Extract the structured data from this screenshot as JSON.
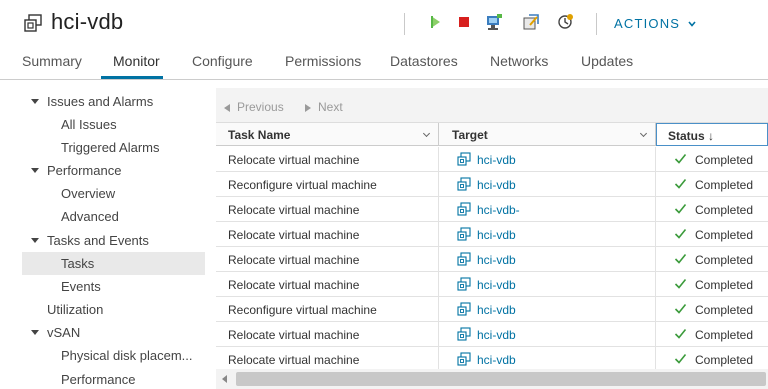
{
  "header": {
    "title": "hci-vdb",
    "actions_label": "ACTIONS",
    "colors": {
      "accent": "#0072a3",
      "power_on": "#57b846",
      "power_off": "#d7201e"
    }
  },
  "tabs": [
    {
      "label": "Summary"
    },
    {
      "label": "Monitor",
      "active": true
    },
    {
      "label": "Configure"
    },
    {
      "label": "Permissions"
    },
    {
      "label": "Datastores"
    },
    {
      "label": "Networks"
    },
    {
      "label": "Updates"
    }
  ],
  "tree": {
    "items": [
      {
        "label": "Issues and Alarms",
        "expandable": true
      },
      {
        "label": "All Issues"
      },
      {
        "label": "Triggered Alarms"
      },
      {
        "label": "Performance",
        "expandable": true
      },
      {
        "label": "Overview"
      },
      {
        "label": "Advanced"
      },
      {
        "label": "Tasks and Events",
        "expandable": true
      },
      {
        "label": "Tasks",
        "selected": true
      },
      {
        "label": "Events"
      },
      {
        "label": "Utilization"
      },
      {
        "label": "vSAN",
        "expandable": true
      },
      {
        "label": "Physical disk placem..."
      },
      {
        "label": "Performance"
      }
    ]
  },
  "pager": {
    "previous": "Previous",
    "next": "Next"
  },
  "table": {
    "columns": [
      {
        "label": "Task Name"
      },
      {
        "label": "Target"
      },
      {
        "label": "Status ↓"
      }
    ],
    "rows": [
      {
        "task": "Relocate virtual machine",
        "target": "hci-vdb",
        "status": "Completed"
      },
      {
        "task": "Reconfigure virtual machine",
        "target": "hci-vdb",
        "status": "Completed"
      },
      {
        "task": "Relocate virtual machine",
        "target": "hci-vdb-",
        "status": "Completed"
      },
      {
        "task": "Relocate virtual machine",
        "target": "hci-vdb",
        "status": "Completed"
      },
      {
        "task": "Relocate virtual machine",
        "target": "hci-vdb",
        "status": "Completed"
      },
      {
        "task": "Relocate virtual machine",
        "target": "hci-vdb",
        "status": "Completed"
      },
      {
        "task": "Reconfigure virtual machine",
        "target": "hci-vdb",
        "status": "Completed"
      },
      {
        "task": "Relocate virtual machine",
        "target": "hci-vdb",
        "status": "Completed"
      },
      {
        "task": "Relocate virtual machine",
        "target": "hci-vdb",
        "status": "Completed"
      }
    ]
  }
}
